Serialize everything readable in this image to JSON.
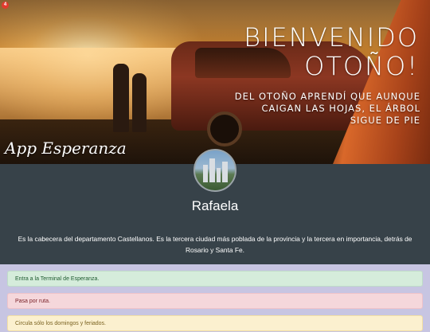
{
  "hero": {
    "badge": "4",
    "title_line1": "BIENVENIDO",
    "title_line2": "OTOÑO!",
    "quote_line1": "DEL OTOÑO APRENDÍ QUE AUNQUE",
    "quote_line2": "CAIGAN LAS HOJAS, EL ÁRBOL",
    "quote_line3": "SIGUE DE PIE",
    "app_name": "App Esperanza"
  },
  "city": {
    "name": "Rafaela",
    "description": "Es la cabecera del departamento Castellanos. Es la tercera ciudad más poblada de la provincia y la tercera en importancia, detrás de Rosario y Santa Fe."
  },
  "alerts": [
    {
      "text": "Entra a la Terminal de Esperanza.",
      "color": "#d5ecdb"
    },
    {
      "text": "Pasa por ruta.",
      "color": "#f5d7db"
    },
    {
      "text": "Circula sólo los domingos y feriados.",
      "color": "#fbf0cf"
    }
  ]
}
